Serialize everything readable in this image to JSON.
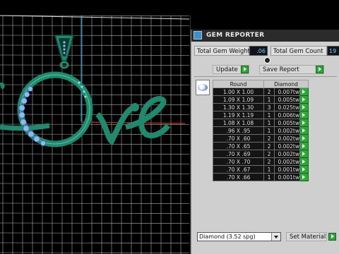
{
  "viewport": {
    "background": "#000000",
    "grid_color": "#b0b0b0",
    "axis_color_y": "#2aa7d6",
    "axis_color_x": "#c0392b",
    "model_color": "#1e8a6e",
    "gem_color": "#8fb8f0"
  },
  "panel": {
    "title": "GEM REPORTER",
    "title_icon": "gem-reporter-icon",
    "total_weight_label": "Total Gem Weight",
    "total_weight_value": ".06",
    "total_count_label": "Total Gem Count",
    "total_count_value": "19",
    "update_label": "Update",
    "save_report_label": "Save Report",
    "thumbnail_icon": "round-gem-icon",
    "table": {
      "headers": [
        "Round",
        "Diamond"
      ],
      "rows": [
        {
          "size": "1.00 X 1.00",
          "count": "2",
          "carat": "0.007tw"
        },
        {
          "size": "1.09 X 1.09",
          "count": "1",
          "carat": "0.005tw"
        },
        {
          "size": "1.30 X 1.30",
          "count": "3",
          "carat": "0.025tw"
        },
        {
          "size": "1.19 X 1.19",
          "count": "1",
          "carat": "0.006tw"
        },
        {
          "size": "1.08 X 1.08",
          "count": "1",
          "carat": "0.005tw"
        },
        {
          "size": ".96 X .95",
          "count": "1",
          "carat": "0.002tw"
        },
        {
          "size": ".70 X .60",
          "count": "2",
          "carat": "0.002tw"
        },
        {
          "size": ".70 X .65",
          "count": "2",
          "carat": "0.002tw"
        },
        {
          "size": ".70 X .69",
          "count": "2",
          "carat": "0.002tw"
        },
        {
          "size": ".70 X .70",
          "count": "2",
          "carat": "0.002tw"
        },
        {
          "size": ".70 X .67",
          "count": "1",
          "carat": "0.001tw"
        },
        {
          "size": ".70 X .66",
          "count": "1",
          "carat": "0.001tw"
        }
      ]
    },
    "material_select": "Diamond     (3.52 spg)",
    "set_material_label": "Set Material",
    "accent_green": "#2fa83a"
  }
}
